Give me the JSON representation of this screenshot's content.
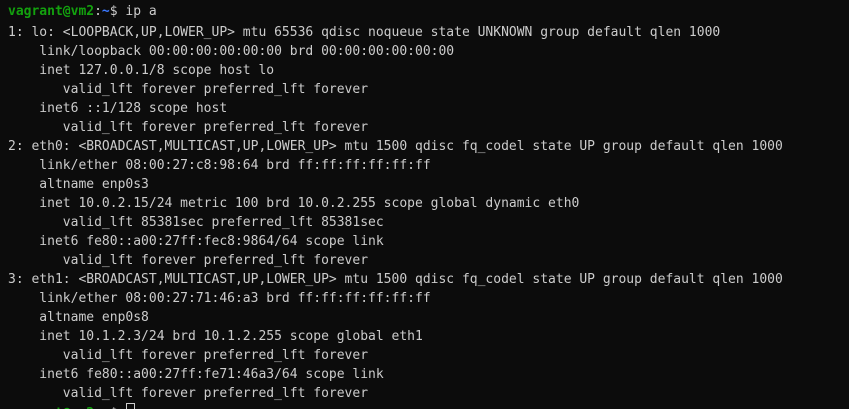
{
  "prompt": {
    "user_host": "vagrant@vm2",
    "separator": ":",
    "path": "~",
    "symbol": "$ "
  },
  "command": "ip a",
  "output": [
    "1: lo: <LOOPBACK,UP,LOWER_UP> mtu 65536 qdisc noqueue state UNKNOWN group default qlen 1000",
    "    link/loopback 00:00:00:00:00:00 brd 00:00:00:00:00:00",
    "    inet 127.0.0.1/8 scope host lo",
    "       valid_lft forever preferred_lft forever",
    "    inet6 ::1/128 scope host",
    "       valid_lft forever preferred_lft forever",
    "2: eth0: <BROADCAST,MULTICAST,UP,LOWER_UP> mtu 1500 qdisc fq_codel state UP group default qlen 1000",
    "    link/ether 08:00:27:c8:98:64 brd ff:ff:ff:ff:ff:ff",
    "    altname enp0s3",
    "    inet 10.0.2.15/24 metric 100 brd 10.0.2.255 scope global dynamic eth0",
    "       valid_lft 85381sec preferred_lft 85381sec",
    "    inet6 fe80::a00:27ff:fec8:9864/64 scope link",
    "       valid_lft forever preferred_lft forever",
    "3: eth1: <BROADCAST,MULTICAST,UP,LOWER_UP> mtu 1500 qdisc fq_codel state UP group default qlen 1000",
    "    link/ether 08:00:27:71:46:a3 brd ff:ff:ff:ff:ff:ff",
    "    altname enp0s8",
    "    inet 10.1.2.3/24 brd 10.1.2.255 scope global eth1",
    "       valid_lft forever preferred_lft forever",
    "    inet6 fe80::a00:27ff:fe71:46a3/64 scope link",
    "       valid_lft forever preferred_lft forever"
  ],
  "colors": {
    "background": "#0c0c0c",
    "text": "#cccccc",
    "prompt_user": "#13a10e",
    "prompt_path": "#3b78ff"
  }
}
